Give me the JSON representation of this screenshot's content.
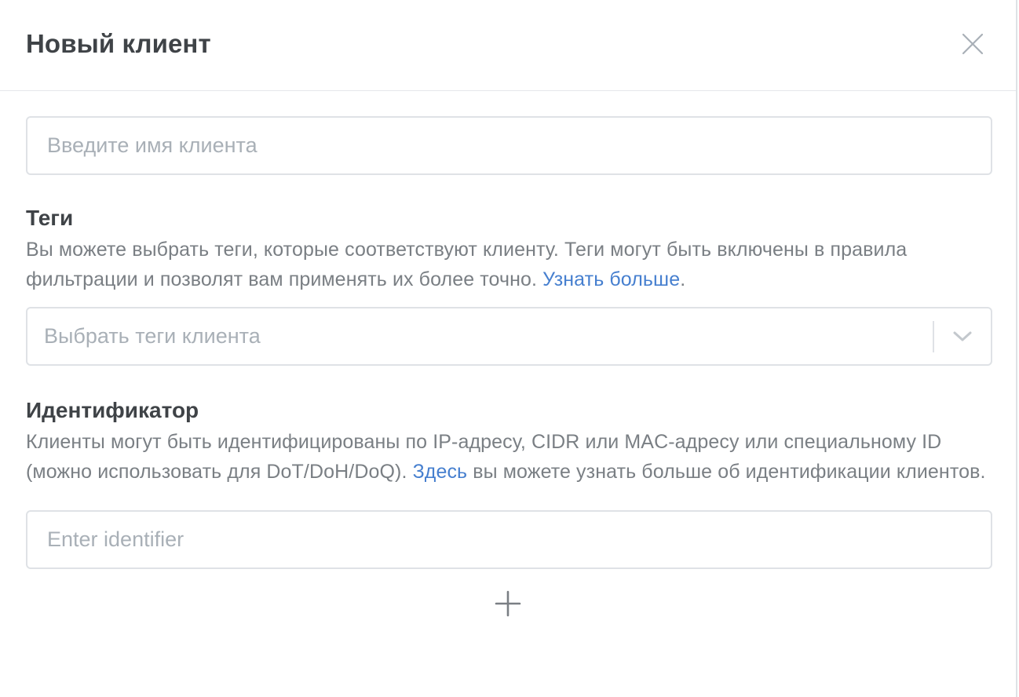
{
  "modal": {
    "title": "Новый клиент",
    "close_icon": "close-icon"
  },
  "name_field": {
    "placeholder": "Введите имя клиента",
    "value": ""
  },
  "tags": {
    "title": "Теги",
    "help_text": "Вы можете выбрать теги, которые соответствуют клиенту. Теги могут быть включены в правила фильтрации и позволят вам применять их более точно. ",
    "help_link": "Узнать больше",
    "help_suffix": ".",
    "select_placeholder": "Выбрать теги клиента",
    "dropdown_icon": "chevron-down-icon"
  },
  "identifier": {
    "title": "Идентификатор",
    "help_text": "Клиенты могут быть идентифицированы по IP-адресу, CIDR или MAC-адресу или специальному ID (можно использовать для DoT/DoH/DoQ). ",
    "help_link": "Здесь",
    "help_suffix": " вы можете узнать больше об идентификации клиентов.",
    "placeholder": "Enter identifier",
    "value": "",
    "add_icon": "plus-icon"
  },
  "colors": {
    "title": "#3f4347",
    "muted": "#7a7f84",
    "placeholder": "#a9b0b7",
    "link": "#467fcf",
    "border": "#dfe2e6"
  }
}
